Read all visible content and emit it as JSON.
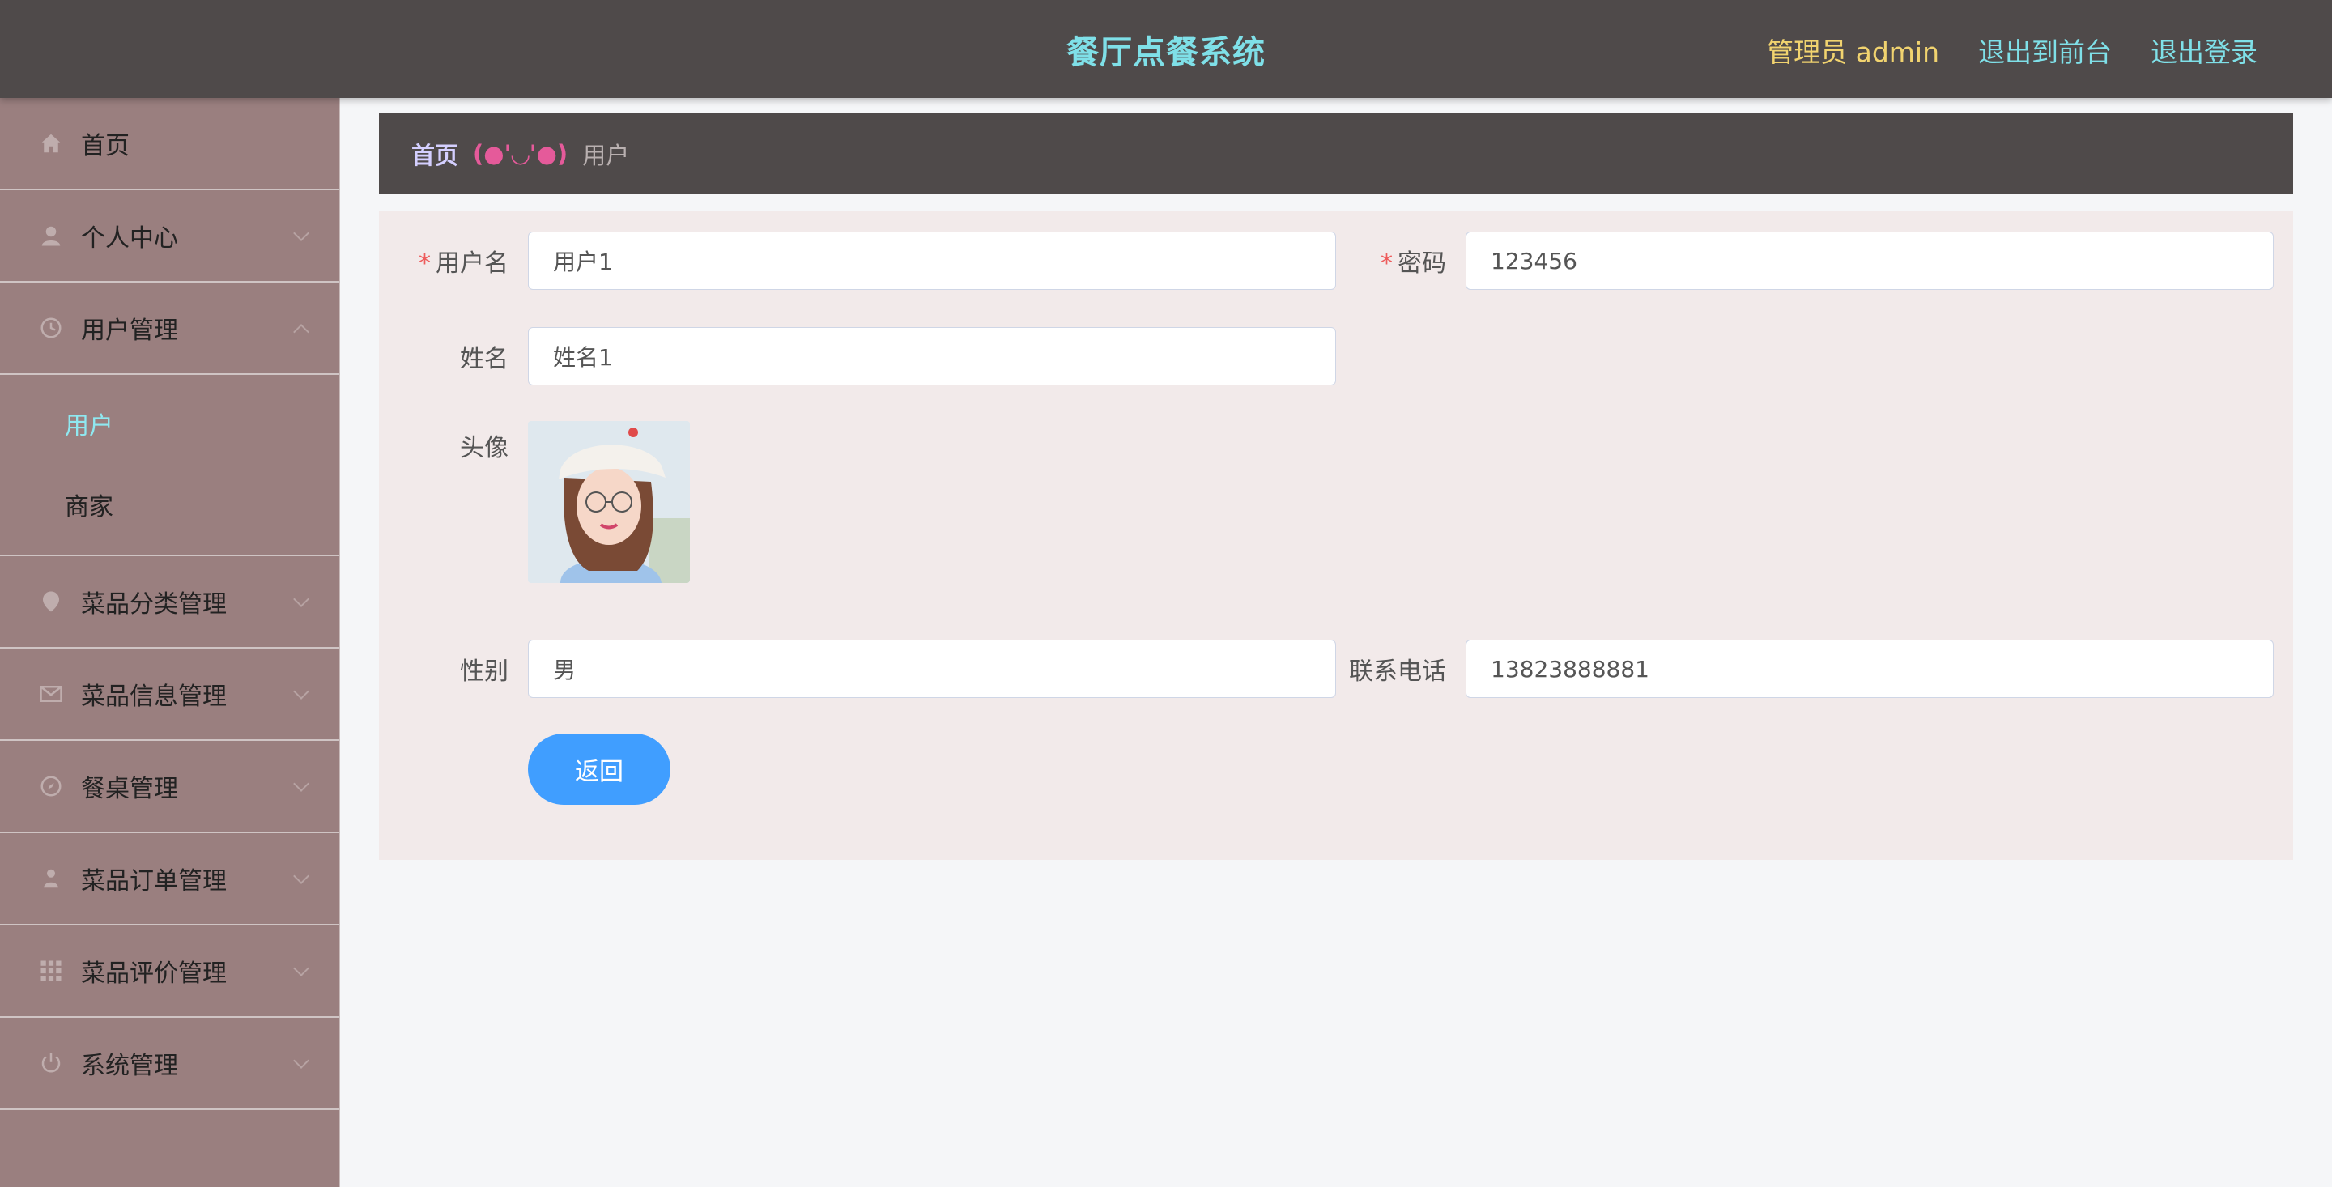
{
  "header": {
    "title": "餐厅点餐系统",
    "admin_label": "管理员 admin",
    "exit_front": "退出到前台",
    "logout": "退出登录"
  },
  "sidebar": {
    "items": [
      {
        "label": "首页",
        "icon": "home-icon"
      },
      {
        "label": "个人中心",
        "icon": "user-icon"
      },
      {
        "label": "用户管理",
        "icon": "clock-icon",
        "expanded": true,
        "children": [
          {
            "label": "用户",
            "active": true
          },
          {
            "label": "商家",
            "active": false
          }
        ]
      },
      {
        "label": "菜品分类管理",
        "icon": "location-icon"
      },
      {
        "label": "菜品信息管理",
        "icon": "mail-icon"
      },
      {
        "label": "餐桌管理",
        "icon": "compass-icon"
      },
      {
        "label": "菜品订单管理",
        "icon": "person-icon"
      },
      {
        "label": "菜品评价管理",
        "icon": "grid-icon"
      },
      {
        "label": "系统管理",
        "icon": "power-icon"
      }
    ]
  },
  "breadcrumb": {
    "home": "首页",
    "separator": "(●'◡'●)",
    "current": "用户"
  },
  "form": {
    "username_label": "用户名",
    "username_value": "用户1",
    "password_label": "密码",
    "password_value": "123456",
    "name_label": "姓名",
    "name_value": "姓名1",
    "avatar_label": "头像",
    "gender_label": "性别",
    "gender_value": "男",
    "phone_label": "联系电话",
    "phone_value": "13823888881",
    "back_button": "返回"
  },
  "colors": {
    "header_bg": "#4f4a4a",
    "title": "#7fe0e8",
    "admin": "#f1d36f",
    "sidebar_bg": "#9a7f7f",
    "active_sub": "#8fe8f0",
    "button": "#409eff",
    "required": "#ee5b5b"
  }
}
